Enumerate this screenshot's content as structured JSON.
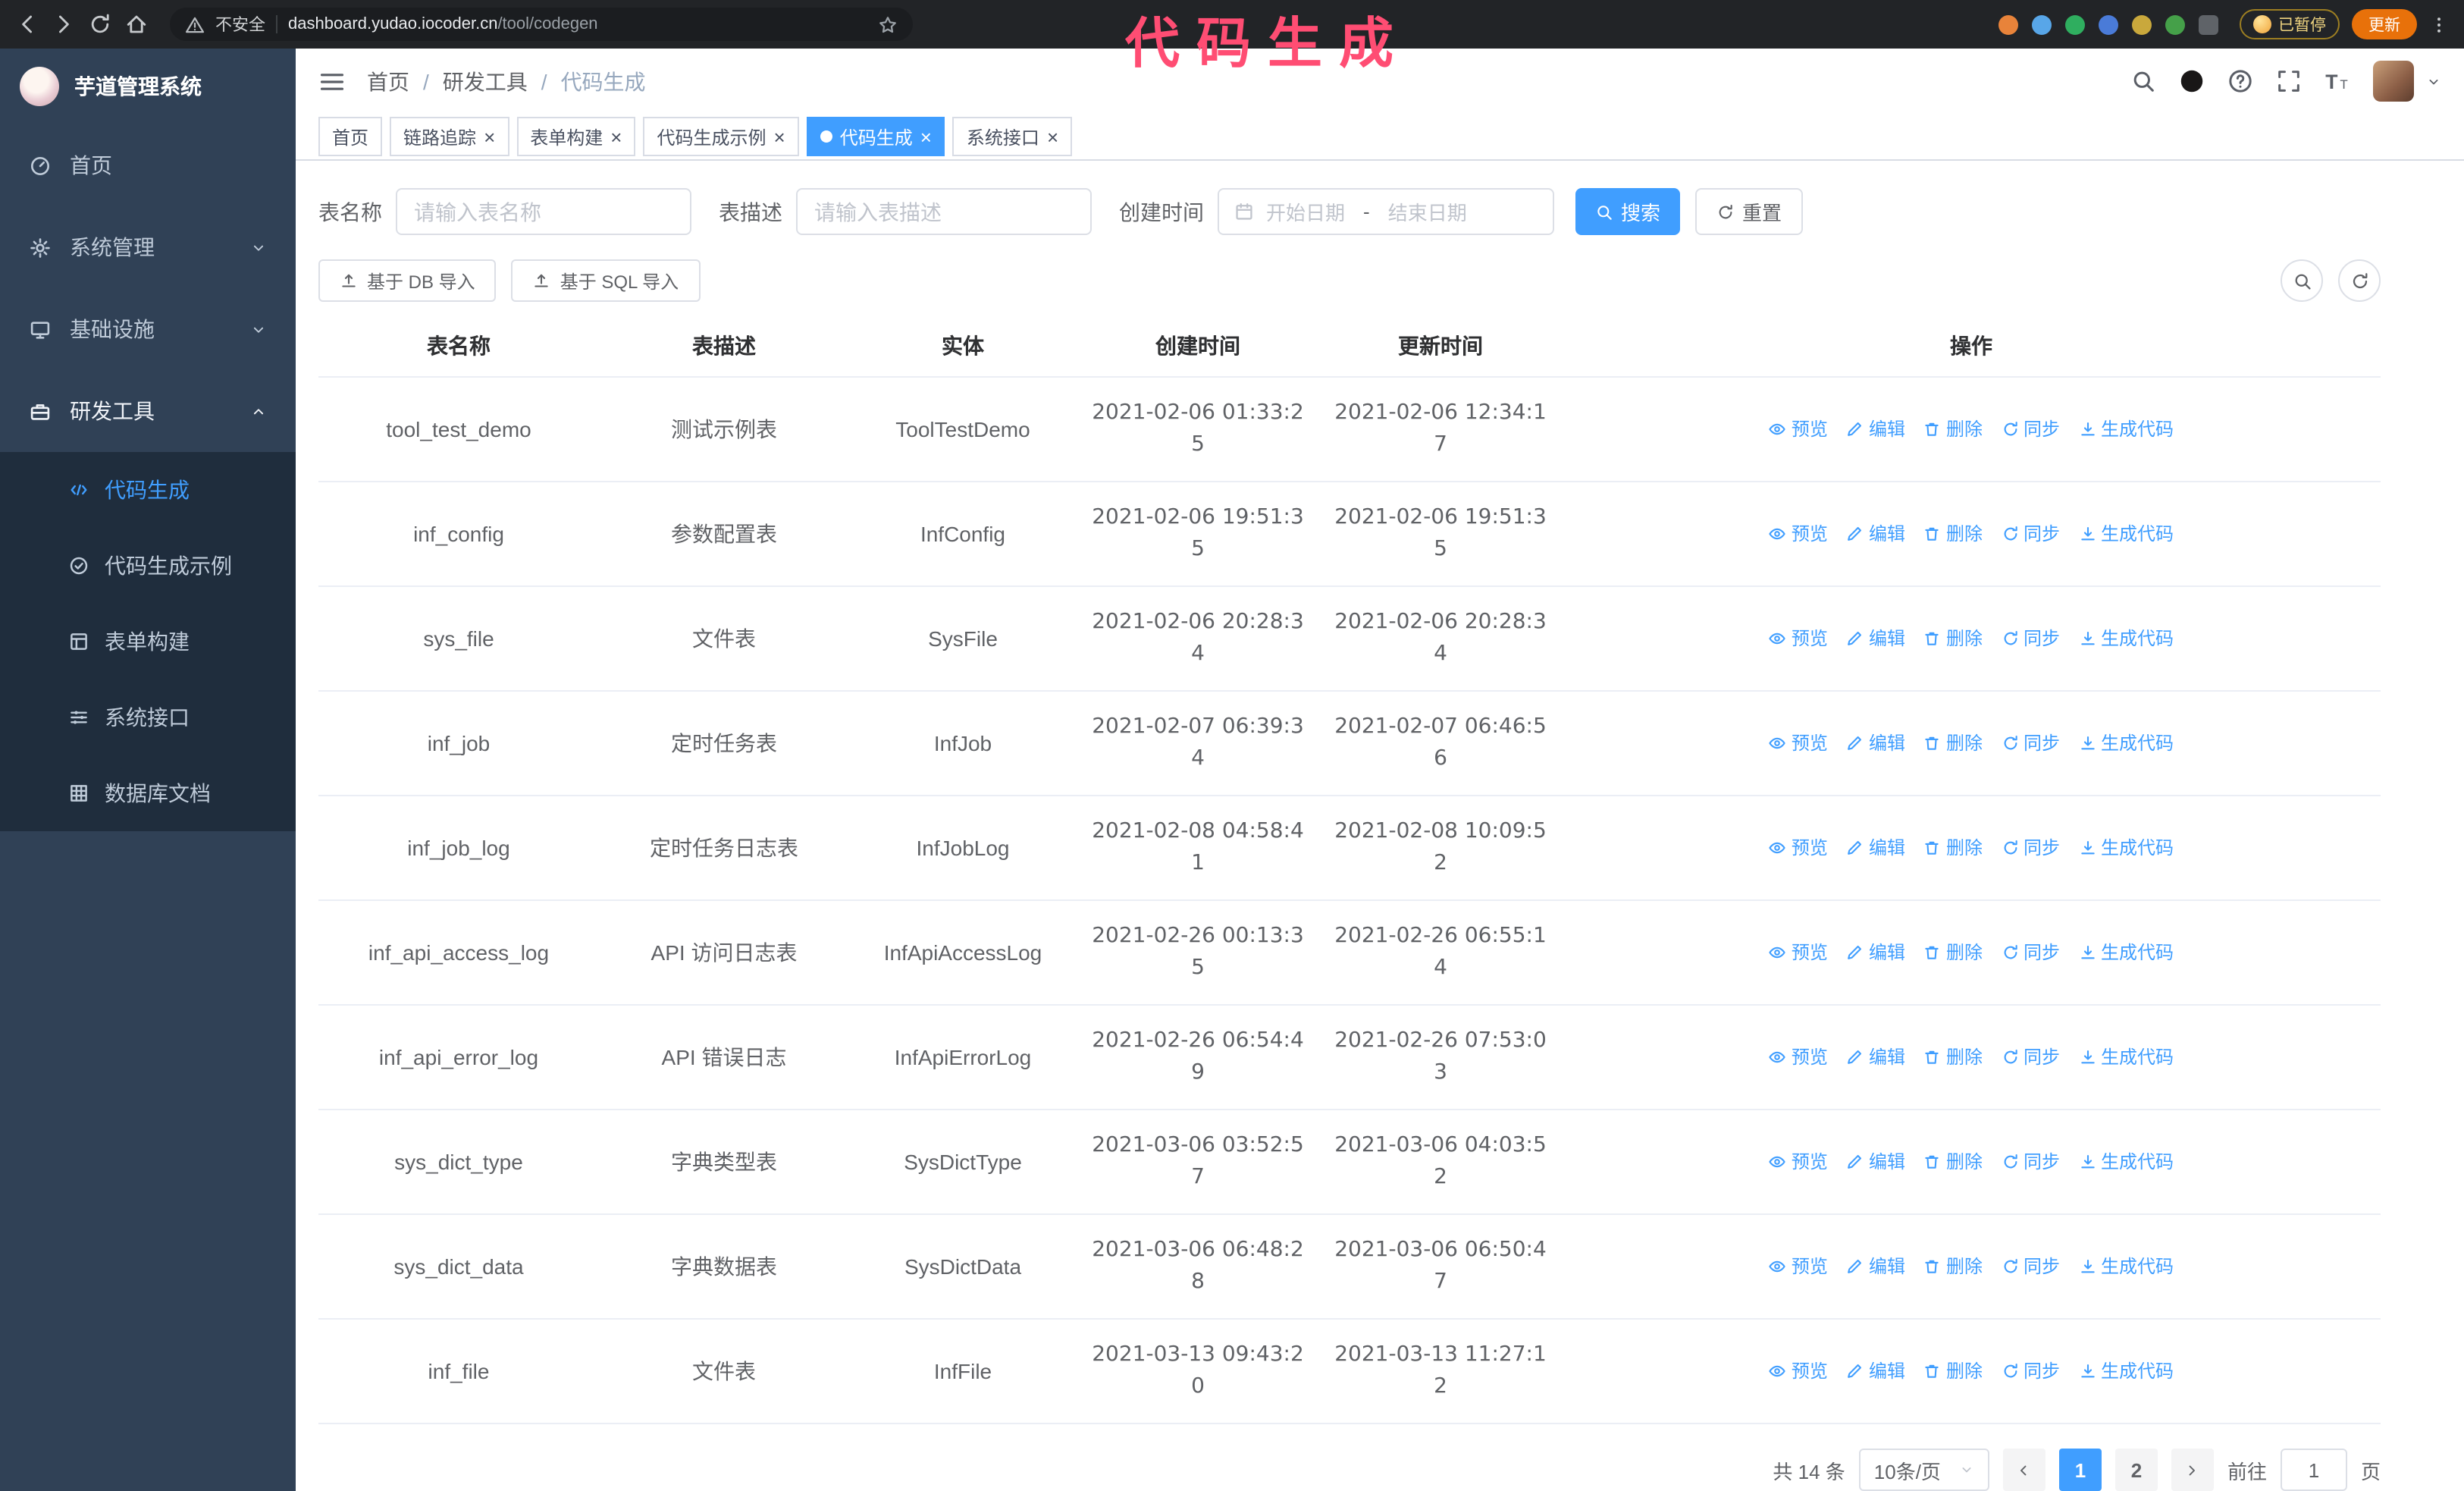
{
  "theme": {
    "accent": "#409eff",
    "sidebar_bg": "#304156",
    "submenu_bg": "#1f2d3d",
    "annotation_color": "#ff4d73"
  },
  "browser": {
    "security_label": "不安全",
    "url_host": "dashboard.yudao.iocoder.cn",
    "url_path": "/tool/codegen",
    "extensions": [
      {
        "name": "extension-orange",
        "color": "#e8833a"
      },
      {
        "name": "extension-blue-drop",
        "color": "#58a6e8"
      },
      {
        "name": "extension-green-v",
        "color": "#2fae5f"
      },
      {
        "name": "extension-people",
        "color": "#4a7bd8"
      },
      {
        "name": "extension-yellow",
        "color": "#c9a83c"
      },
      {
        "name": "extension-leaf",
        "color": "#45a049"
      },
      {
        "name": "extension-puzzle",
        "color": "#5f6368"
      }
    ],
    "paused_badge": "已暂停",
    "update_button": "更新"
  },
  "annotation": {
    "text": "代码生成"
  },
  "sidebar": {
    "title": "芋道管理系统",
    "items": [
      {
        "id": "home",
        "label": "首页",
        "icon": "dashboard"
      },
      {
        "id": "system",
        "label": "系统管理",
        "icon": "gear",
        "expandable": true
      },
      {
        "id": "infrastructure",
        "label": "基础设施",
        "icon": "monitor",
        "expandable": true
      },
      {
        "id": "devtools",
        "label": "研发工具",
        "icon": "toolbox",
        "expandable": true,
        "expanded": true
      }
    ],
    "submenu": [
      {
        "id": "codegen",
        "label": "代码生成",
        "icon": "code",
        "active": true
      },
      {
        "id": "codegen-example",
        "label": "代码生成示例",
        "icon": "badge"
      },
      {
        "id": "form-builder",
        "label": "表单构建",
        "icon": "form"
      },
      {
        "id": "system-api",
        "label": "系统接口",
        "icon": "api"
      },
      {
        "id": "db-doc",
        "label": "数据库文档",
        "icon": "grid"
      }
    ]
  },
  "header": {
    "breadcrumb": [
      "首页",
      "研发工具",
      "代码生成"
    ]
  },
  "tabs": [
    {
      "label": "首页",
      "closable": false,
      "active": false
    },
    {
      "label": "链路追踪",
      "closable": true,
      "active": false
    },
    {
      "label": "表单构建",
      "closable": true,
      "active": false
    },
    {
      "label": "代码生成示例",
      "closable": true,
      "active": false
    },
    {
      "label": "代码生成",
      "closable": true,
      "active": true
    },
    {
      "label": "系统接口",
      "closable": true,
      "active": false
    }
  ],
  "filters": {
    "name_label": "表名称",
    "name_placeholder": "请输入表名称",
    "desc_label": "表描述",
    "desc_placeholder": "请输入表描述",
    "time_label": "创建时间",
    "start_placeholder": "开始日期",
    "range_separator": "-",
    "end_placeholder": "结束日期",
    "search_button": "搜索",
    "reset_button": "重置"
  },
  "toolbar": {
    "import_db_button": "基于 DB 导入",
    "import_sql_button": "基于 SQL 导入"
  },
  "table": {
    "columns": [
      "表名称",
      "表描述",
      "实体",
      "创建时间",
      "更新时间",
      "操作"
    ],
    "actions": [
      {
        "label": "预览",
        "icon": "eye",
        "name": "preview"
      },
      {
        "label": "编辑",
        "icon": "edit",
        "name": "edit"
      },
      {
        "label": "删除",
        "icon": "trash",
        "name": "delete"
      },
      {
        "label": "同步",
        "icon": "sync",
        "name": "sync"
      },
      {
        "label": "生成代码",
        "icon": "download",
        "name": "generate-code"
      }
    ],
    "rows": [
      {
        "name": "tool_test_demo",
        "desc": "测试示例表",
        "entity": "ToolTestDemo",
        "created": "2021-02-06 01:33:25",
        "updated": "2021-02-06 12:34:17"
      },
      {
        "name": "inf_config",
        "desc": "参数配置表",
        "entity": "InfConfig",
        "created": "2021-02-06 19:51:35",
        "updated": "2021-02-06 19:51:35"
      },
      {
        "name": "sys_file",
        "desc": "文件表",
        "entity": "SysFile",
        "created": "2021-02-06 20:28:34",
        "updated": "2021-02-06 20:28:34"
      },
      {
        "name": "inf_job",
        "desc": "定时任务表",
        "entity": "InfJob",
        "created": "2021-02-07 06:39:34",
        "updated": "2021-02-07 06:46:56"
      },
      {
        "name": "inf_job_log",
        "desc": "定时任务日志表",
        "entity": "InfJobLog",
        "created": "2021-02-08 04:58:41",
        "updated": "2021-02-08 10:09:52"
      },
      {
        "name": "inf_api_access_log",
        "desc": "API 访问日志表",
        "entity": "InfApiAccessLog",
        "created": "2021-02-26 00:13:35",
        "updated": "2021-02-26 06:55:14"
      },
      {
        "name": "inf_api_error_log",
        "desc": "API 错误日志",
        "entity": "InfApiErrorLog",
        "created": "2021-02-26 06:54:49",
        "updated": "2021-02-26 07:53:03"
      },
      {
        "name": "sys_dict_type",
        "desc": "字典类型表",
        "entity": "SysDictType",
        "created": "2021-03-06 03:52:57",
        "updated": "2021-03-06 04:03:52"
      },
      {
        "name": "sys_dict_data",
        "desc": "字典数据表",
        "entity": "SysDictData",
        "created": "2021-03-06 06:48:28",
        "updated": "2021-03-06 06:50:47"
      },
      {
        "name": "inf_file",
        "desc": "文件表",
        "entity": "InfFile",
        "created": "2021-03-13 09:43:20",
        "updated": "2021-03-13 11:27:12"
      }
    ]
  },
  "pagination": {
    "total_label": "共 14 条",
    "page_size": "10条/页",
    "pages": [
      "1",
      "2"
    ],
    "active_page": "1",
    "goto_label": "前往",
    "goto_value": "1",
    "goto_unit": "页"
  }
}
